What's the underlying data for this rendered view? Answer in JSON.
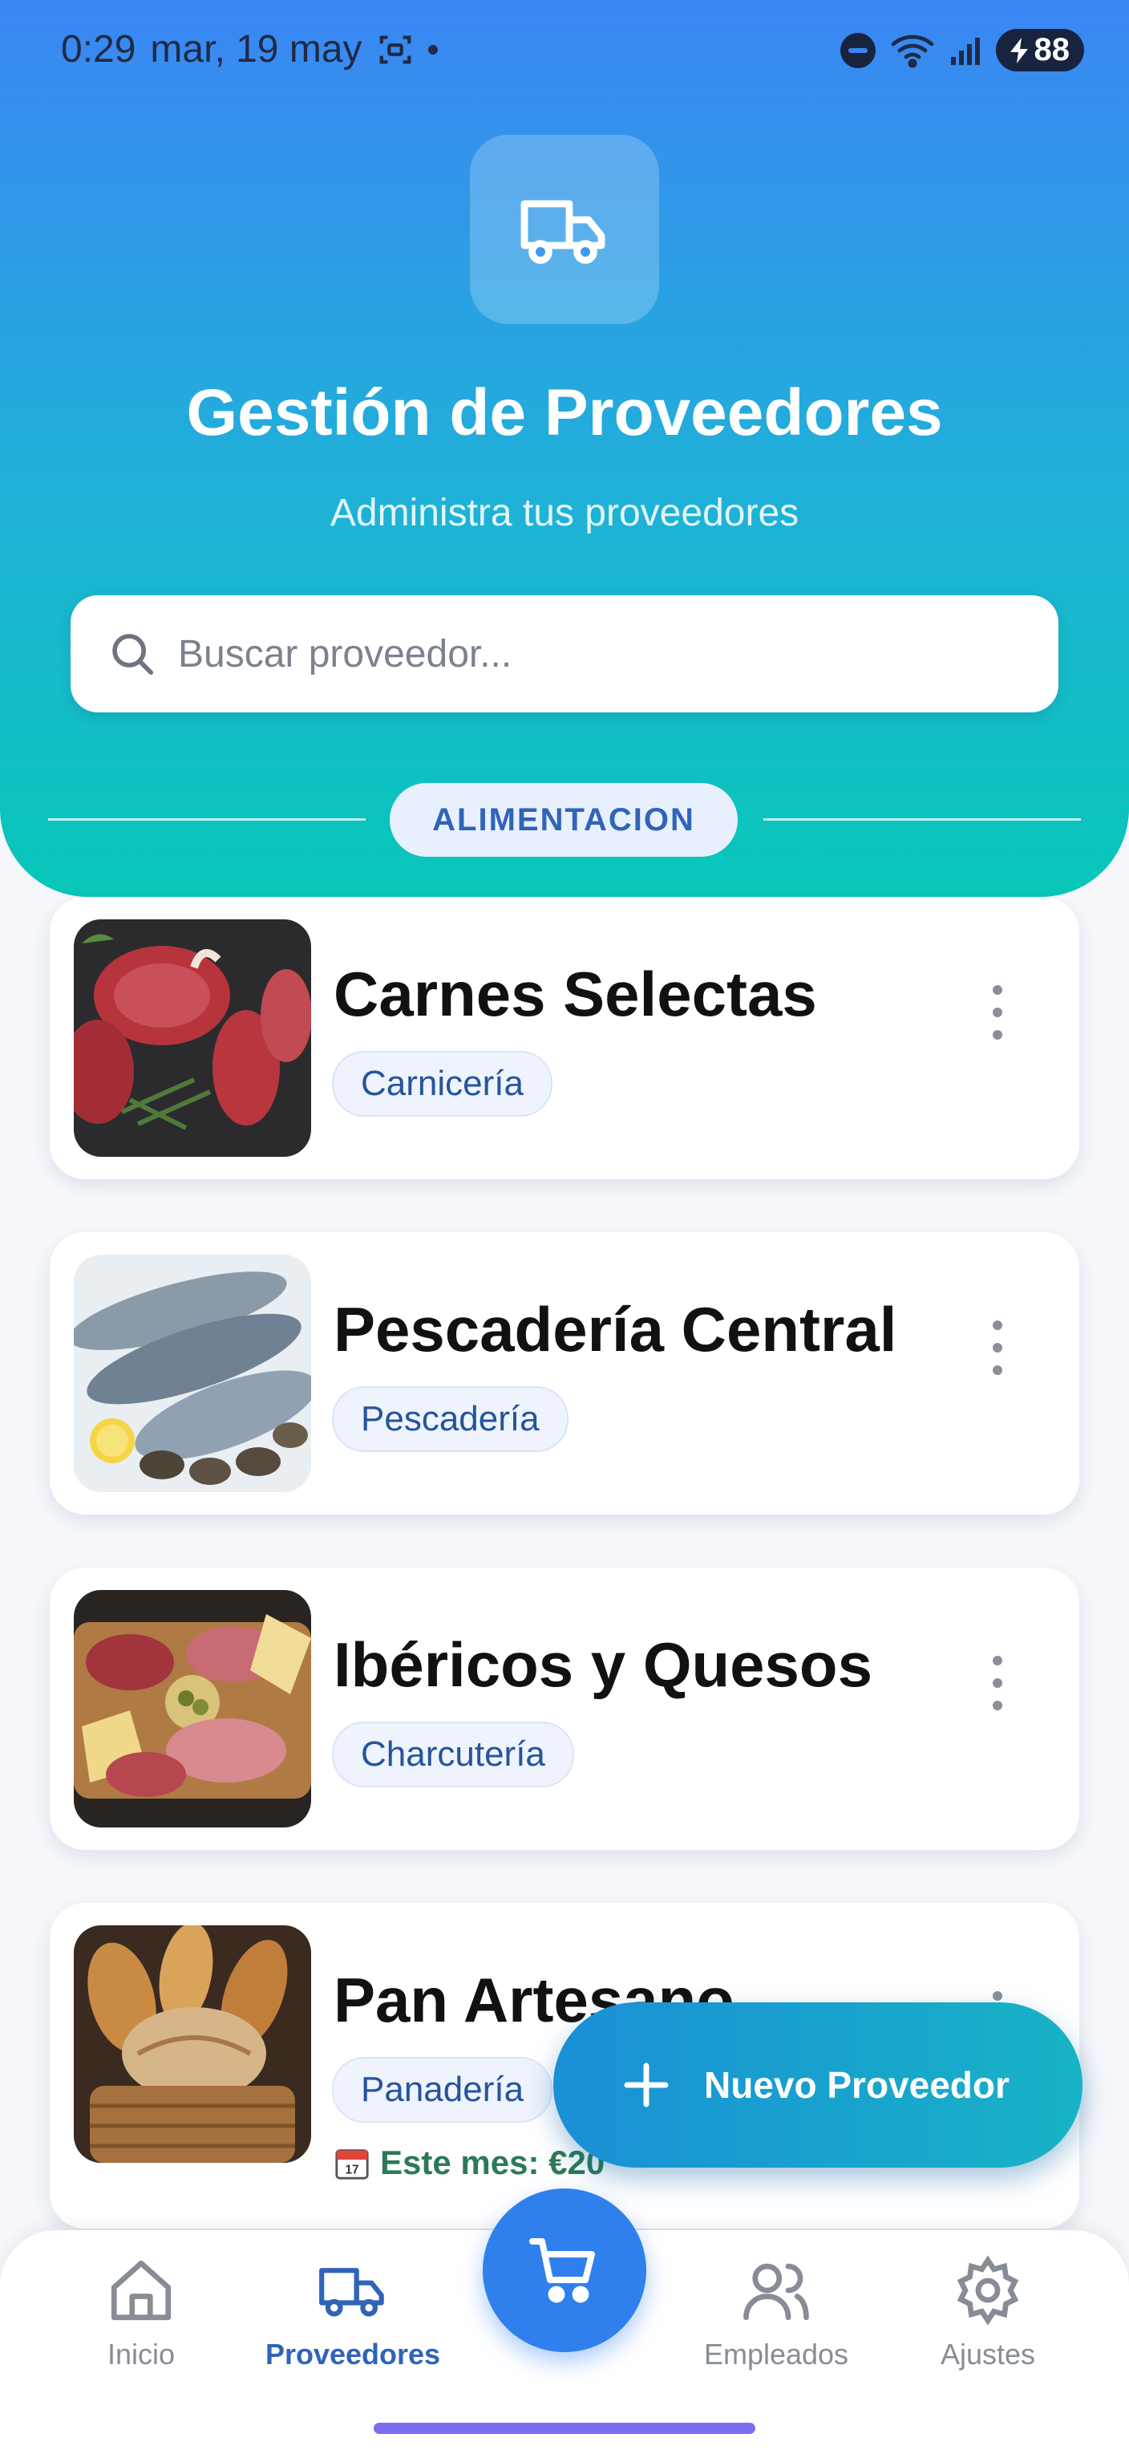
{
  "status": {
    "time": "0:29",
    "date": "mar, 19 may",
    "battery": "88"
  },
  "header": {
    "title": "Gestión de Proveedores",
    "subtitle": "Administra tus proveedores",
    "icon": "truck-icon"
  },
  "search": {
    "placeholder": "Buscar proveedor..."
  },
  "section": {
    "label": "ALIMENTACION"
  },
  "suppliers": [
    {
      "name": "Carnes Selectas",
      "category": "Carnicería",
      "image": "meat-photo"
    },
    {
      "name": "Pescadería Central",
      "category": "Pescadería",
      "image": "fish-photo"
    },
    {
      "name": "Ibéricos y Quesos",
      "category": "Charcutería",
      "image": "charcuterie-photo"
    },
    {
      "name": "Pan Artesano",
      "category": "Panadería",
      "image": "bread-photo",
      "month_label": "Este mes: €20"
    }
  ],
  "fab": {
    "label": "Nuevo Proveedor"
  },
  "nav": [
    {
      "label": "Inicio",
      "icon": "home-icon"
    },
    {
      "label": "Proveedores",
      "icon": "truck-icon",
      "active": true
    },
    {
      "label": "",
      "icon": "cart-icon"
    },
    {
      "label": "Empleados",
      "icon": "users-icon"
    },
    {
      "label": "Ajustes",
      "icon": "gear-icon"
    }
  ],
  "colors": {
    "accent": "#2f80ed",
    "header_top": "#3b86f4",
    "header_bottom": "#08c7b8",
    "chip_text": "#25549c"
  }
}
